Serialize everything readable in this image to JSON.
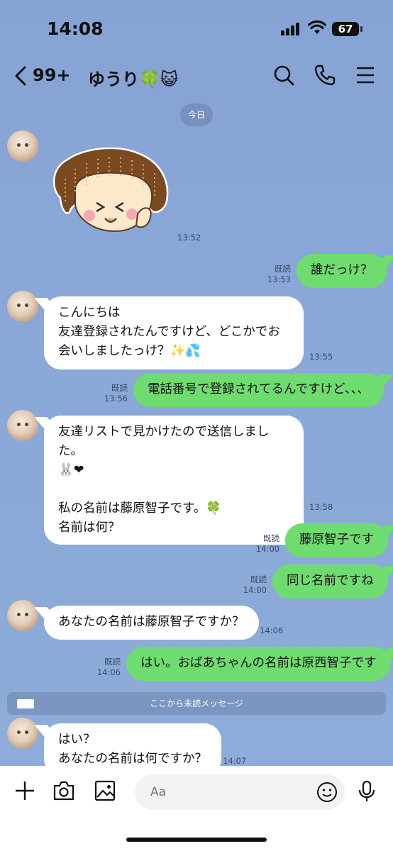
{
  "status": {
    "time": "14:08",
    "battery": "67"
  },
  "header": {
    "unread_count": "99+",
    "title": "ゆうり🍀😺"
  },
  "date_label": "今日",
  "messages": [
    {
      "side": "in",
      "type": "sticker",
      "time": "13:52"
    },
    {
      "side": "out",
      "text": "誰だっけ？",
      "read": "既読",
      "time": "13:53"
    },
    {
      "side": "in",
      "text": "こんにちは\n友達登録されたんですけど、どこかでお会いしましたっけ？✨💦",
      "time": "13:55"
    },
    {
      "side": "out",
      "text": "電話番号で登録されてるんですけど、、、",
      "read": "既読",
      "time": "13:56"
    },
    {
      "side": "in",
      "text": "友達リストで見かけたので送信しました。\n🐰❤\n\n私の名前は藤原智子です。🍀\n名前は何？",
      "time": "13:58"
    },
    {
      "side": "out",
      "text": "藤原智子です",
      "read": "既読",
      "time": "14:00"
    },
    {
      "side": "out",
      "text": "同じ名前ですね",
      "read": "既読",
      "time": "14:00"
    },
    {
      "side": "in",
      "text": "あなたの名前は藤原智子ですか？",
      "time": "14:06"
    },
    {
      "side": "out",
      "text": "はい。おばあちゃんの名前は原西智子です",
      "read": "既読",
      "time": "14:06"
    },
    {
      "side": "in",
      "text": "はい？\nあなたの名前は何ですか？",
      "time": "14:07"
    }
  ],
  "unread_divider": "ここから未読メッセージ",
  "input": {
    "placeholder": "Aa"
  },
  "colors": {
    "background": "#8aa8d8",
    "outgoing_bubble": "#6fdc6f",
    "incoming_bubble": "#ffffff"
  }
}
